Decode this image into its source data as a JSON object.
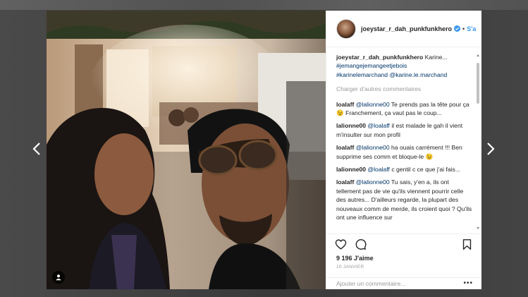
{
  "post": {
    "username": "joeystar_r_dah_punkfunkhero",
    "follow_label": "S'a",
    "header_separator": "•",
    "caption": {
      "username": "joeystar_r_dah_punkfunkhero",
      "text": " Karine...",
      "hashtags": [
        "#jemangejemangeetjebois",
        "#karinelemarchand"
      ],
      "mention": " @karine.le.marchand"
    },
    "load_more": "Charger d'autres commentaires",
    "comments": [
      {
        "user": "loalaff",
        "mention": "@lalionne00",
        "text": " Te prends pas la tête pour ça 😉 Franchement, ça vaut pas le coup..."
      },
      {
        "user": "lalionne00",
        "mention": "@loalaff",
        "text": " il est malade le gah il vient m'insulter sur mon profil"
      },
      {
        "user": "loalaff",
        "mention": "@lalionne00",
        "text": " ha ouais carrément !!! Ben supprime ses comm et bloque-le 😉"
      },
      {
        "user": "lalionne00",
        "mention": "@loalaff",
        "text": " c gentil c ce que j'ai fais..."
      },
      {
        "user": "loalaff",
        "mention": "@lalionne00",
        "text": " Tu sais, y'en a, ils ont tellement pas de vie qu'ils viennent pourrir celle des autres... D'ailleurs regarde, la plupart des nouveaux comm de merde, ils croient quoi ? Qu'ils ont une influence sur"
      }
    ],
    "likes": "9 196 J'aime",
    "date": "10 JANVIER",
    "add_comment_placeholder": "Ajouter un commentaire...",
    "more_options": "•••"
  },
  "icons": {
    "prev": "chevron-left-icon",
    "next": "chevron-right-icon",
    "like": "heart-icon",
    "comment": "comment-bubble-icon",
    "save": "bookmark-icon",
    "tag": "user-tag-icon",
    "verified": "verified-badge-icon"
  },
  "colors": {
    "link": "#3897f0",
    "mention": "#003569",
    "muted": "#999999",
    "text": "#262626"
  }
}
